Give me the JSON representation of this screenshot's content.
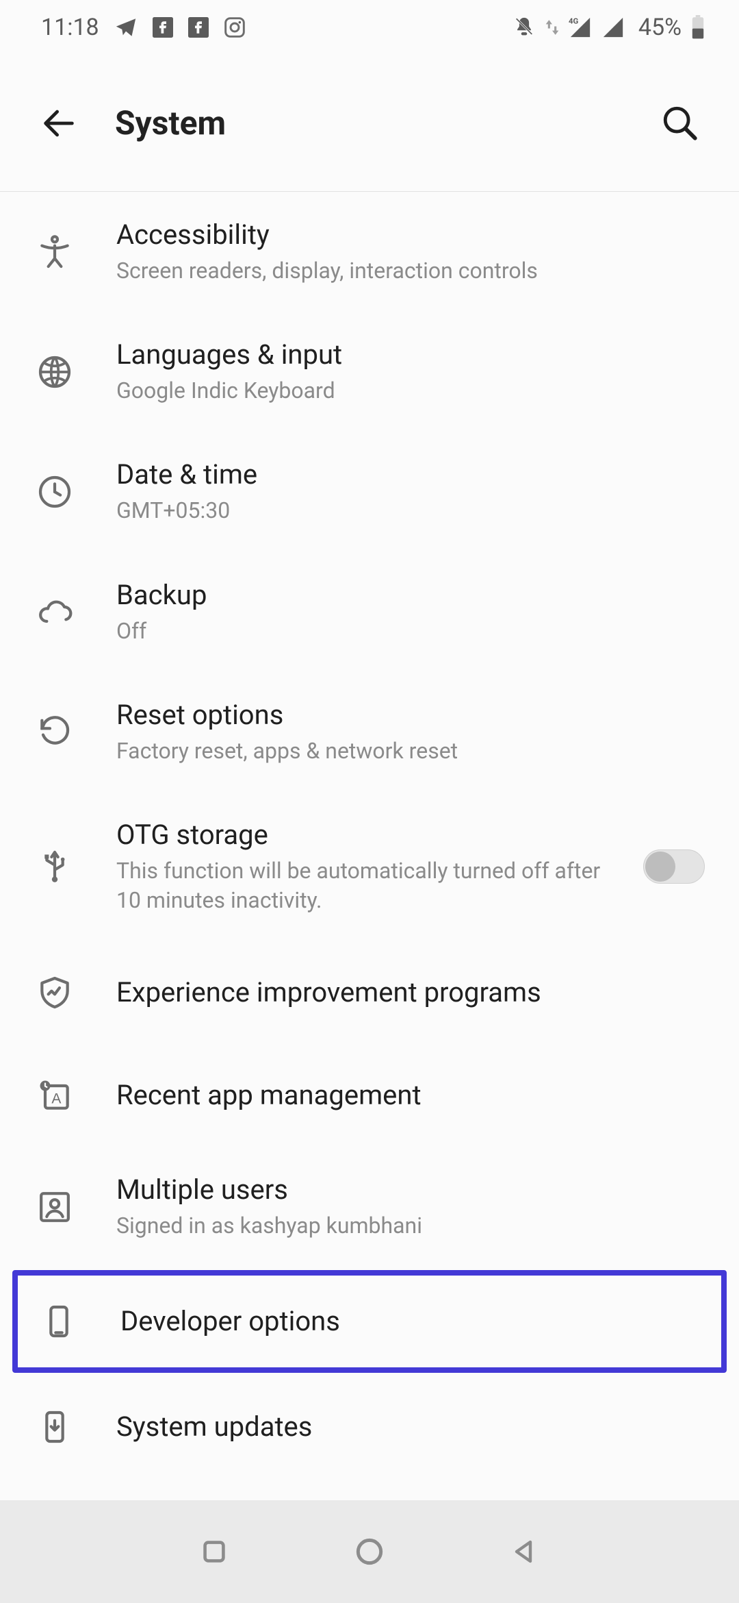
{
  "status": {
    "time": "11:18",
    "battery": "45%"
  },
  "header": {
    "title": "System"
  },
  "items": [
    {
      "title": "Accessibility",
      "sub": "Screen readers, display, interaction controls"
    },
    {
      "title": "Languages & input",
      "sub": "Google Indic Keyboard"
    },
    {
      "title": "Date & time",
      "sub": "GMT+05:30"
    },
    {
      "title": "Backup",
      "sub": "Off"
    },
    {
      "title": "Reset options",
      "sub": "Factory reset, apps & network reset"
    },
    {
      "title": "OTG storage",
      "sub": "This function will be automatically turned off after 10 minutes inactivity."
    },
    {
      "title": "Experience improvement programs",
      "sub": ""
    },
    {
      "title": "Recent app management",
      "sub": ""
    },
    {
      "title": "Multiple users",
      "sub": "Signed in as kashyap kumbhani"
    },
    {
      "title": "Developer options",
      "sub": ""
    },
    {
      "title": "System updates",
      "sub": ""
    }
  ]
}
